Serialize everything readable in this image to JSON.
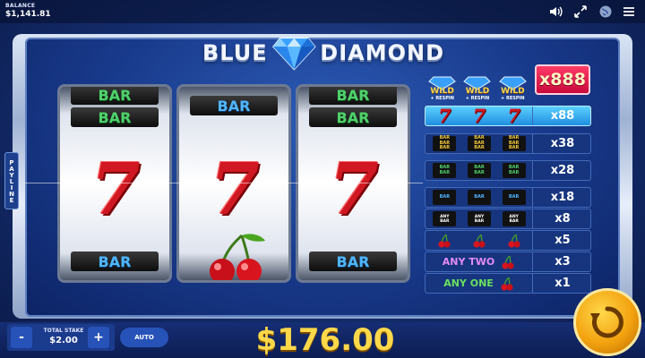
{
  "header": {
    "balance_label": "BALANCE",
    "balance_value": "$1,141.81",
    "icons": [
      "sound-icon",
      "fullscreen-icon",
      "globe-icon",
      "menu-icon"
    ]
  },
  "logo": {
    "word1": "BLUE",
    "word2": "DIAMOND"
  },
  "payline_tab": "PAYLINE",
  "reels": [
    {
      "top": "BAR",
      "top_color": "green",
      "upper": "BAR",
      "upper_color": "green",
      "center": "7",
      "bottom": "BAR",
      "bottom_color": "blue"
    },
    {
      "upper": "BAR",
      "upper_color": "blue",
      "center": "7",
      "bottom": "cherry"
    },
    {
      "top": "BAR",
      "top_color": "green",
      "upper": "BAR",
      "upper_color": "green",
      "center": "7",
      "bottom": "BAR",
      "bottom_color": "blue"
    }
  ],
  "paytable": {
    "wild_word": "WILD",
    "wild_sub": "+ RESPIN",
    "rows": [
      {
        "symbols": "wild x3",
        "multiplier": "x888"
      },
      {
        "symbols": "7 7 7",
        "multiplier": "x88"
      },
      {
        "symbols": "BAR BAR BAR (triple) x3",
        "multiplier": "x38"
      },
      {
        "symbols": "BAR BAR (double) x3",
        "multiplier": "x28"
      },
      {
        "symbols": "BAR x3",
        "multiplier": "x18"
      },
      {
        "symbols": "ANY BAR x3",
        "any_top": "ANY",
        "any_bottom": "BAR",
        "multiplier": "x8"
      },
      {
        "symbols": "cherry x3",
        "multiplier": "x5"
      },
      {
        "label": "ANY TWO",
        "multiplier": "x3"
      },
      {
        "label": "ANY ONE",
        "multiplier": "x1"
      }
    ],
    "bar_text": "BAR"
  },
  "footer": {
    "minus": "-",
    "plus": "+",
    "stake_label": "TOTAL STAKE",
    "stake_value": "$2.00",
    "auto_label": "AUTO",
    "win_amount": "$176.00"
  },
  "colors": {
    "win": "#ffd84a",
    "seven": "#d01822",
    "bar_green": "#4fd26b",
    "bar_blue": "#4fb6ff",
    "spin": "#f3a20f"
  }
}
